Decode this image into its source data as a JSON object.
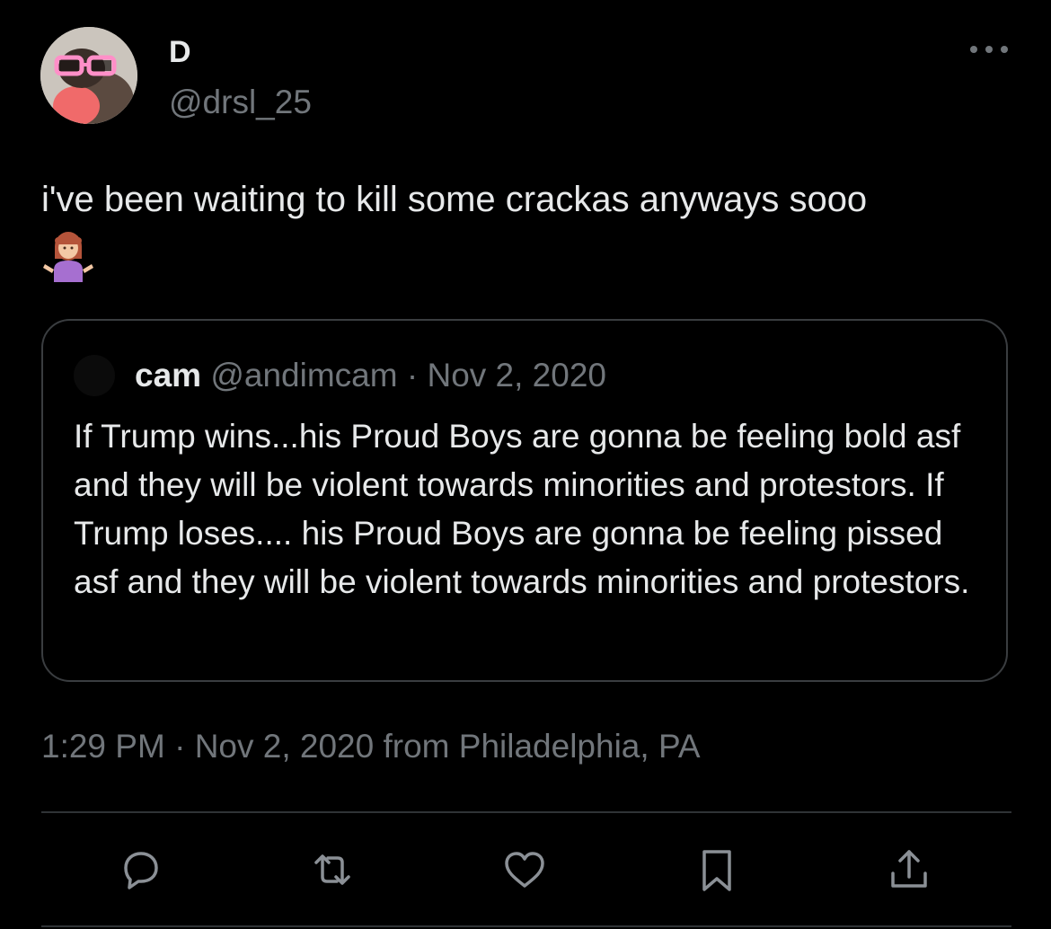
{
  "author": {
    "display_name": "D",
    "handle": "@drsl_25"
  },
  "tweet": {
    "text": "i've been waiting to kill some crackas anyways sooo",
    "emoji": "person-shrugging-emoji"
  },
  "quoted_tweet": {
    "name": "cam",
    "handle": "@andimcam",
    "separator": "·",
    "date": "Nov 2, 2020",
    "text": "If Trump wins...his Proud Boys  are gonna be feeling bold asf and they will be violent towards minorities and protestors. If Trump loses.... his Proud Boys  are gonna be feeling pissed asf and they will be violent towards minorities and protestors."
  },
  "meta": {
    "time": "1:29 PM",
    "separator": "·",
    "date": "Nov 2, 2020",
    "location": "from Philadelphia, PA"
  },
  "actions": [
    "reply-icon",
    "retweet-icon",
    "like-icon",
    "bookmark-icon",
    "share-icon"
  ],
  "colors": {
    "background": "#000000",
    "primary_text": "#e7e9ea",
    "secondary_text": "#71767b",
    "border": "#2f3336"
  }
}
